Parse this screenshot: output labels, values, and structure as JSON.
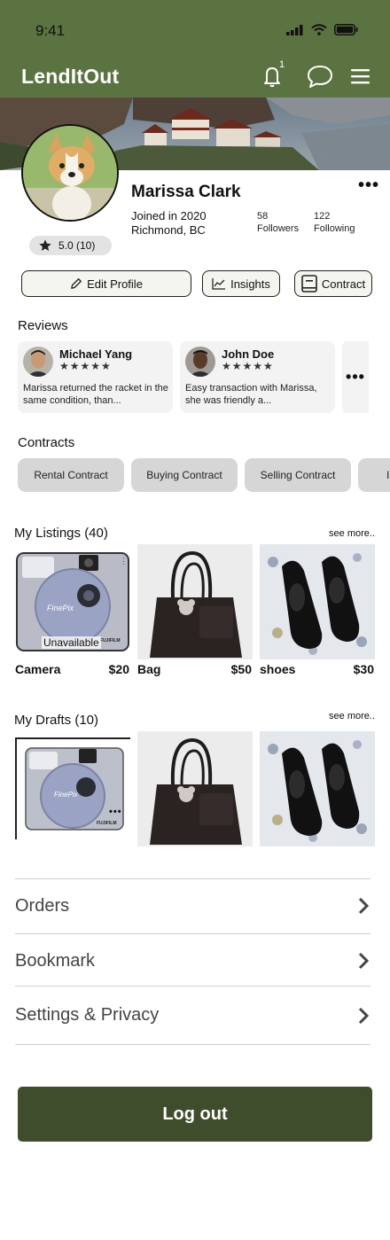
{
  "status": {
    "time": "9:41"
  },
  "header": {
    "app_title": "LendItOut",
    "notification_count": "1"
  },
  "profile": {
    "name": "Marissa Clark",
    "joined": "Joined in 2020",
    "location": "Richmond, BC",
    "followers_count": "58",
    "followers_label": "Followers",
    "following_count": "122",
    "following_label": "Following",
    "rating": "5.0 (10)"
  },
  "actions": {
    "edit_profile": "Edit Profile",
    "insights": "Insights",
    "contract": "Contract"
  },
  "reviews": {
    "title": "Reviews",
    "items": [
      {
        "name": "Michael Yang",
        "stars": "★★★★★",
        "text": "Marissa returned the racket in the same condition, than..."
      },
      {
        "name": "John Doe",
        "stars": "★★★★★",
        "text": "Easy transaction with Marissa, she was friendly a..."
      }
    ]
  },
  "contracts": {
    "title": "Contracts",
    "chips": [
      "Rental Contract",
      "Buying Contract",
      "Selling Contract",
      "In"
    ]
  },
  "listings": {
    "title": "My Listings (40)",
    "see_more": "see more..",
    "unavailable_label": "Unavailable",
    "items": [
      {
        "name": "Camera",
        "price": "$20"
      },
      {
        "name": "Bag",
        "price": "$50"
      },
      {
        "name": "shoes",
        "price": "$30"
      }
    ]
  },
  "drafts": {
    "title": "My Drafts (10)",
    "see_more": "see more.."
  },
  "camera_brand": {
    "model": "FinePix",
    "maker": "FUJIFILM"
  },
  "menu": {
    "items": [
      "Orders",
      "Bookmark",
      "Settings & Privacy"
    ]
  },
  "logout_label": "Log out",
  "colors": {
    "header_green": "#5a7340",
    "logout_green": "#3f4d2c"
  }
}
